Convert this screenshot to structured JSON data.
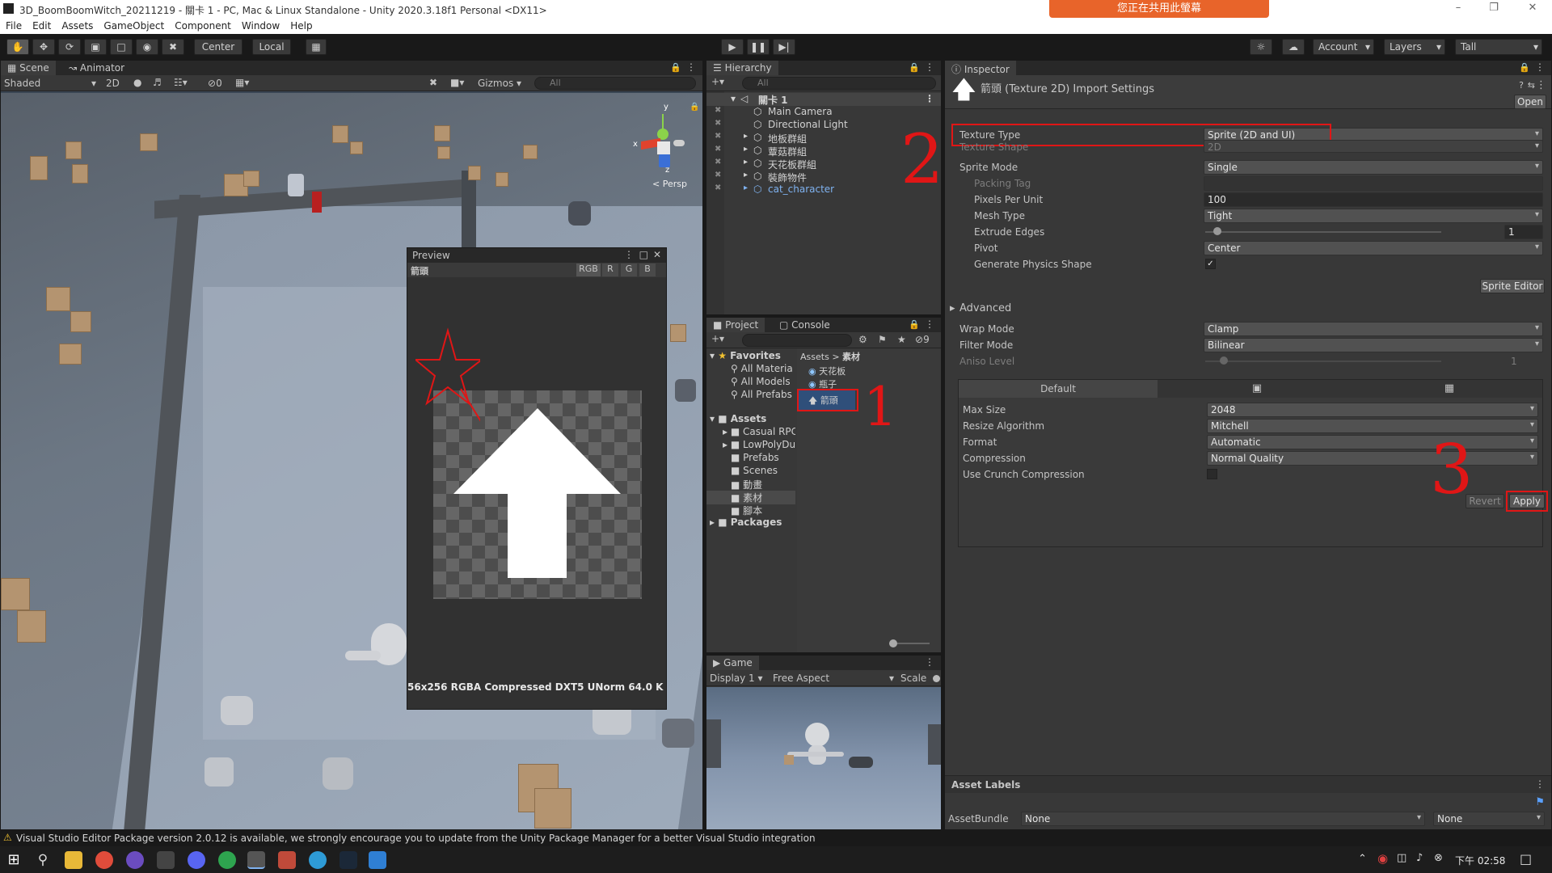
{
  "window": {
    "title": "3D_BoomBoomWitch_20211219 - 關卡 1 - PC, Mac & Linux Standalone - Unity 2020.3.18f1 Personal <DX11>",
    "share_banner": "您正在共用此螢幕"
  },
  "menu": [
    "File",
    "Edit",
    "Assets",
    "GameObject",
    "Component",
    "Window",
    "Help"
  ],
  "toolbar": {
    "pivot": "Center",
    "space": "Local",
    "account": "Account",
    "layers": "Layers",
    "layout": "Tall"
  },
  "scene": {
    "tab_scene": "Scene",
    "tab_animator": "Animator",
    "shading": "Shaded",
    "mode_2d": "2D",
    "hidden_count": "0",
    "gizmos": "Gizmos",
    "search_placeholder": "All",
    "persp": "Persp",
    "axis_y": "y",
    "axis_x": "x",
    "axis_z": "z"
  },
  "preview": {
    "title": "Preview",
    "asset_name": "箭頭",
    "channels": [
      "RGB",
      "R",
      "G",
      "B"
    ],
    "info": "56x256  RGBA Compressed DXT5 UNorm   64.0 K"
  },
  "hierarchy": {
    "tab": "Hierarchy",
    "search_placeholder": "All",
    "scene_name": "關卡 1",
    "items": [
      {
        "label": "Main Camera",
        "indent": 1
      },
      {
        "label": "Directional Light",
        "indent": 1
      },
      {
        "label": "地板群組",
        "indent": 1
      },
      {
        "label": "蕈菇群組",
        "indent": 1
      },
      {
        "label": "天花板群組",
        "indent": 1
      },
      {
        "label": "裝飾物件",
        "indent": 1
      },
      {
        "label": "cat_character",
        "indent": 1
      }
    ]
  },
  "project": {
    "tab_project": "Project",
    "tab_console": "Console",
    "hidden_count": "9",
    "favorites": "Favorites",
    "fav_items": [
      "All Materia",
      "All Models",
      "All Prefabs"
    ],
    "assets": "Assets",
    "asset_folders": [
      "Casual RPC",
      "LowPolyDu",
      "Prefabs",
      "Scenes",
      "動畫",
      "素材",
      "腳本"
    ],
    "packages": "Packages",
    "breadcrumb_root": "Assets",
    "breadcrumb_sep": ">",
    "breadcrumb_folder": "素材",
    "files": [
      "天花板",
      "瓶子",
      "箭頭"
    ]
  },
  "game": {
    "tab": "Game",
    "display": "Display 1",
    "aspect": "Free Aspect",
    "scale": "Scale"
  },
  "inspector": {
    "tab": "Inspector",
    "header": "箭頭 (Texture 2D) Import Settings",
    "open_button": "Open",
    "rows": [
      {
        "key": "texture_type",
        "label": "Texture Type",
        "value": "Sprite (2D and UI)"
      },
      {
        "key": "texture_shape",
        "label": "Texture Shape",
        "value": "2D"
      },
      {
        "key": "sprite_mode",
        "label": "Sprite Mode",
        "value": "Single"
      },
      {
        "key": "packing_tag",
        "label": "Packing Tag",
        "value": ""
      },
      {
        "key": "ppu",
        "label": "Pixels Per Unit",
        "value": "100"
      },
      {
        "key": "mesh_type",
        "label": "Mesh Type",
        "value": "Tight"
      },
      {
        "key": "extrude",
        "label": "Extrude Edges",
        "value": "1"
      },
      {
        "key": "pivot",
        "label": "Pivot",
        "value": "Center"
      },
      {
        "key": "physics",
        "label": "Generate Physics Shape",
        "value": "true"
      }
    ],
    "sprite_editor_button": "Sprite Editor",
    "advanced": "Advanced",
    "wrap_mode_label": "Wrap Mode",
    "wrap_mode": "Clamp",
    "filter_mode_label": "Filter Mode",
    "filter_mode": "Bilinear",
    "aniso_label": "Aniso Level",
    "aniso_value": "1",
    "platform_default": "Default",
    "max_size_label": "Max Size",
    "max_size": "2048",
    "resize_label": "Resize Algorithm",
    "resize": "Mitchell",
    "format_label": "Format",
    "format": "Automatic",
    "compression_label": "Compression",
    "compression": "Normal Quality",
    "crunch_label": "Use Crunch Compression",
    "revert_button": "Revert",
    "apply_button": "Apply",
    "asset_labels": "Asset Labels",
    "assetbundle_label": "AssetBundle",
    "assetbundle_value": "None",
    "assetbundle_variant": "None"
  },
  "annotations": {
    "n1": "1",
    "n2": "2",
    "n3": "3"
  },
  "status_message": "Visual Studio Editor Package version 2.0.12 is available, we strongly encourage you to update from the Unity Package Manager for a better Visual Studio integration",
  "taskbar": {
    "time": "下午 02:58"
  },
  "colors": {
    "annotation": "#e01616",
    "share_banner": "#e8642a",
    "panel_bg": "#383838"
  }
}
